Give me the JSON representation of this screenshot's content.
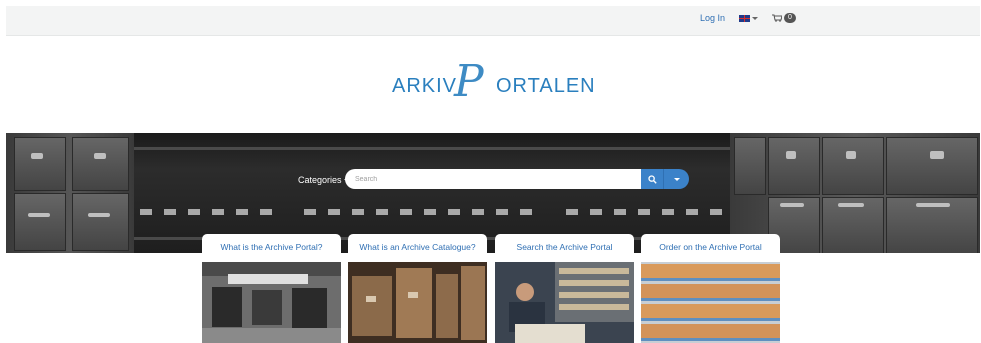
{
  "header": {
    "login_label": "Log In",
    "language_icon": "uk-flag-icon",
    "cart_count": "0"
  },
  "logo": {
    "left_text": "ARKIV",
    "right_text": "ORTALEN",
    "script_letter": "P"
  },
  "search": {
    "categories_label": "Categories",
    "placeholder": "Search"
  },
  "cards": [
    {
      "title": "What is the Archive Portal?"
    },
    {
      "title": "What is an Archive Catalogue?"
    },
    {
      "title": "Search the Archive Portal"
    },
    {
      "title": "Order on the Archive Portal"
    }
  ],
  "colors": {
    "accent": "#2a7fbe",
    "link": "#2f6fb3",
    "search_button": "#3b82c9",
    "topbar": "#f3f4f4"
  }
}
